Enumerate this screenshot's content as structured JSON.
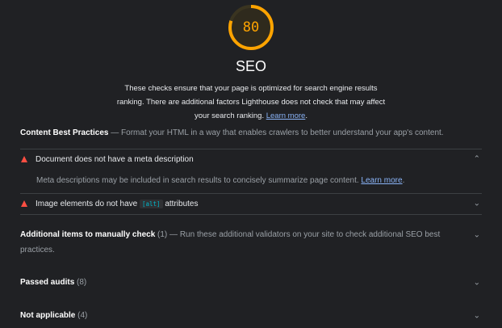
{
  "category": {
    "score": "80",
    "score_value": 80,
    "score_color": "#ffa400",
    "title": "SEO",
    "description": "These checks ensure that your page is optimized for search engine results ranking. There are additional factors Lighthouse does not check that may affect your search ranking.",
    "learn_more": "Learn more",
    "period": "."
  },
  "content_best_practices": {
    "title": "Content Best Practices",
    "dash": " — ",
    "description": "Format your HTML in a way that enables crawlers to better understand your app's content."
  },
  "audits": [
    {
      "title": "Document does not have a meta description",
      "expanded": true,
      "details": "Meta descriptions may be included in search results to concisely summarize page content.",
      "learn_more": "Learn more",
      "period": "."
    },
    {
      "title_before": "Image elements do not have ",
      "code": "[alt]",
      "title_after": " attributes",
      "expanded": false
    }
  ],
  "manual": {
    "title": "Additional items to manually check",
    "count": " (1)",
    "dash": " — ",
    "description": "Run these additional validators on your site to check additional SEO best practices."
  },
  "passed": {
    "title": "Passed audits",
    "count": " (8)"
  },
  "not_applicable": {
    "title": "Not applicable",
    "count": " (4)"
  },
  "icons": {
    "expand": "chevron-down-icon",
    "collapse": "chevron-up-icon",
    "fail": "warning-triangle-icon"
  }
}
